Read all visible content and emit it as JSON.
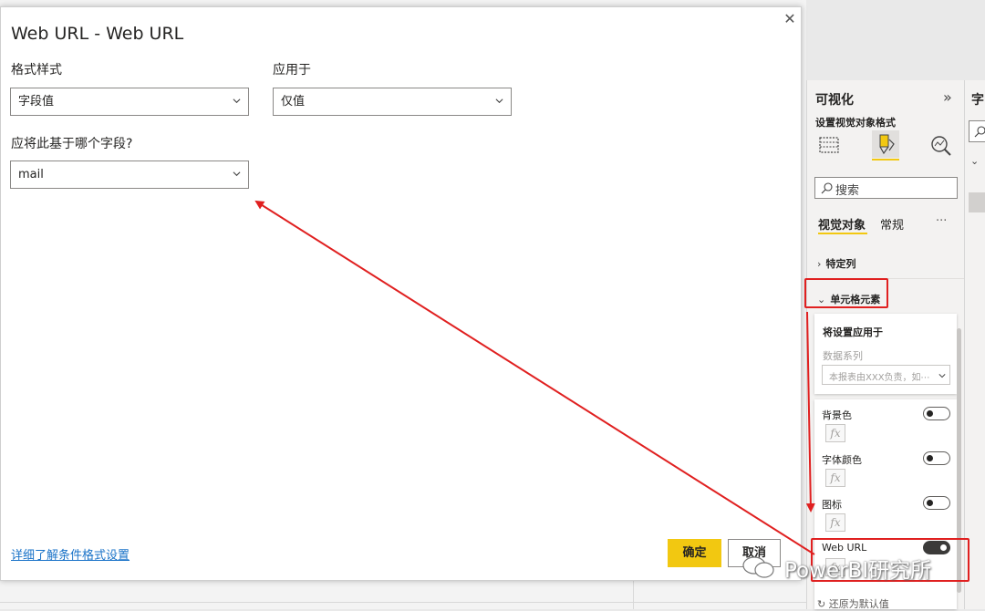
{
  "dialog": {
    "title": "Web URL - Web URL",
    "format_style_label": "格式样式",
    "format_style_value": "字段值",
    "apply_to_label": "应用于",
    "apply_to_value": "仅值",
    "field_question": "应将此基于哪个字段?",
    "field_value": "mail",
    "learn_link": "详细了解条件格式设置",
    "ok_label": "确定",
    "cancel_label": "取消"
  },
  "viz_pane": {
    "title": "可视化",
    "expand_icon": "»",
    "subtitle": "设置视觉对象格式",
    "search_placeholder": "搜索",
    "tab_visual": "视觉对象",
    "tab_general": "常规",
    "more": "···",
    "section_specific_column": "特定列",
    "section_cell_elements": "单元格元素",
    "apply_settings_title": "将设置应用于",
    "series_label": "数据系列",
    "series_value": "本报表由XXX负责，如⋯",
    "rows": [
      {
        "label": "背景色",
        "on": false
      },
      {
        "label": "字体颜色",
        "on": false
      },
      {
        "label": "图标",
        "on": false
      },
      {
        "label": "Web URL",
        "on": true
      }
    ],
    "fx_label": "fx",
    "reset_label": "还原为默认值"
  },
  "fields_pane": {
    "title": "字"
  },
  "watermark": "PowerBI研究所",
  "colors": {
    "accent_yellow": "#f2c811",
    "annotation_red": "#e02020",
    "link_blue": "#1a73c8"
  }
}
